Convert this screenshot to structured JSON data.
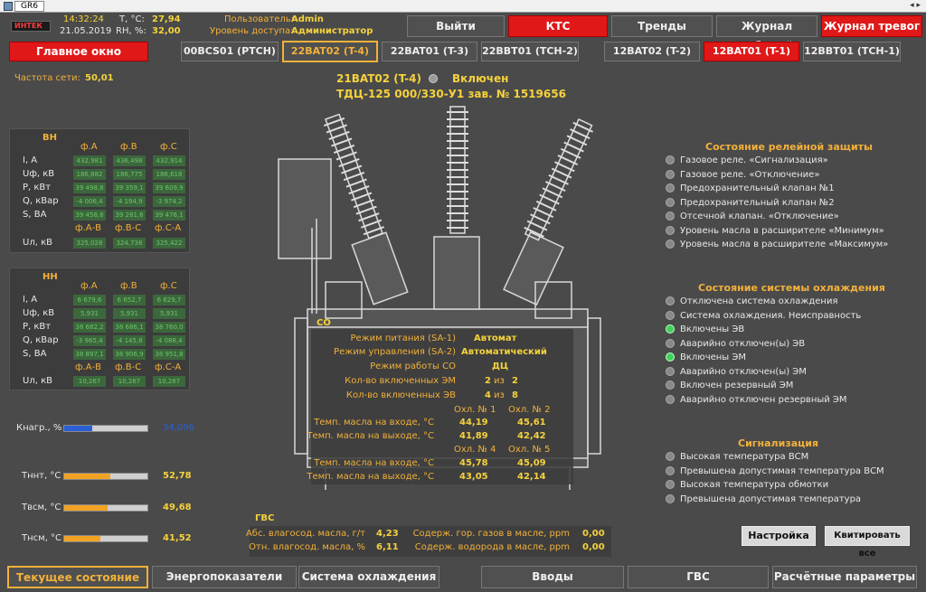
{
  "window": {
    "tab": "GR6",
    "arrows": "◂ ▸"
  },
  "header": {
    "logo": "ИНТЕК",
    "time": "14:32:24",
    "date": "21.05.2019",
    "temp_label": "T, °C:",
    "temp_value": "27,94",
    "rh_label": "RH, %:",
    "rh_value": "32,00",
    "user_label": "Пользователь:",
    "user_value": "Admin",
    "access_label": "Уровень доступа:",
    "access_value": "Администратор"
  },
  "top_buttons": {
    "exit": "Выйти",
    "kts": "КТС",
    "trends": "Тренды",
    "events": "Журнал событий",
    "alarms": "Журнал тревог"
  },
  "main_window_button": "Главное окно",
  "unit_tabs": [
    "00BCS01 (PTCH)",
    "22BAT02 (T-4)",
    "22BAT01 (T-3)",
    "22BBT01 (TCH-2)",
    "12BAT02 (T-2)",
    "12BAT01 (T-1)",
    "12BBT01 (TCH-1)"
  ],
  "frequency": {
    "label": "Частота сети:",
    "value": "50,01"
  },
  "transformer": {
    "name": "21BAT02 (T-4)",
    "state": "Включен",
    "model": "ТДЦ-125 000/330-У1 зав. № 1519656"
  },
  "vn": {
    "title": "ВН",
    "phase_headers": [
      "ф.А",
      "ф.В",
      "ф.С"
    ],
    "rows": [
      {
        "label": "I, А",
        "values": [
          "432,981",
          "436,498",
          "432,914"
        ]
      },
      {
        "label": "Uф, кВ",
        "values": [
          "186,882",
          "186,775",
          "186,618"
        ]
      },
      {
        "label": "P, кВт",
        "values": [
          "39 498,8",
          "39 359,1",
          "39 609,9"
        ]
      },
      {
        "label": "Q, кВар",
        "values": [
          "-4 006,4",
          "-4 194,9",
          "-3 974,2"
        ]
      },
      {
        "label": "S, ВА",
        "values": [
          "39 458,8",
          "39 281,6",
          "39 476,1"
        ]
      }
    ],
    "line_headers": [
      "ф.А-В",
      "ф.В-С",
      "ф.С-А"
    ],
    "ul_label": "Uл, кВ",
    "ul_values": [
      "325,028",
      "324,738",
      "325,422"
    ]
  },
  "nn": {
    "title": "НН",
    "phase_headers": [
      "ф.А",
      "ф.В",
      "ф.С"
    ],
    "rows": [
      {
        "label": "I, А",
        "values": [
          "6 679,6",
          "6 652,7",
          "6 629,7"
        ]
      },
      {
        "label": "Uф, кВ",
        "values": [
          "5,931",
          "5,931",
          "5,931"
        ]
      },
      {
        "label": "P, кВт",
        "values": [
          "38 682,2",
          "38 686,1",
          "38 760,0"
        ]
      },
      {
        "label": "Q, кВар",
        "values": [
          "-3 965,4",
          "-4 145,8",
          "-4 088,4"
        ]
      },
      {
        "label": "S, ВА",
        "values": [
          "38 897,1",
          "38 906,9",
          "38 951,8"
        ]
      }
    ],
    "line_headers": [
      "ф.А-В",
      "ф.В-С",
      "ф.С-А"
    ],
    "ul_label": "Uл, кВ",
    "ul_values": [
      "10,267",
      "10,267",
      "10,267"
    ]
  },
  "gauges": {
    "load": {
      "label": "Кнагр., %",
      "value": "34,096",
      "fraction": 0.34,
      "color": "#2b5fd8"
    },
    "tnnt": {
      "label": "Tннт, °C",
      "value": "52,78",
      "fraction": 0.55,
      "color": "#f2a324"
    },
    "tvsm": {
      "label": "Tвсм, °C",
      "value": "49,68",
      "fraction": 0.52,
      "color": "#f2a324"
    },
    "tnsm": {
      "label": "Tнсм, °C",
      "value": "41,52",
      "fraction": 0.44,
      "color": "#f2a324"
    }
  },
  "co": {
    "title": "СО",
    "rows": [
      {
        "label": "Режим питания (SA-1)",
        "value": "Автомат"
      },
      {
        "label": "Режим управления (SA-2)",
        "value": "Автоматический"
      },
      {
        "label": "Режим работы СО",
        "value": "ДЦ"
      }
    ],
    "em_label": "Кол-во включенных ЭМ",
    "em_value": "2",
    "em_of": "из",
    "em_total": "2",
    "ev_label": "Кол-во включенных ЭВ",
    "ev_value": "4",
    "ev_of": "из",
    "ev_total": "8",
    "cooler_headers_1": [
      "Охл. № 1",
      "Охл. № 2"
    ],
    "cooler_headers_2": [
      "Охл. № 4",
      "Охл. № 5"
    ],
    "in_label": "Темп. масла на входе, °C",
    "out_label": "Темп. масла на выходе, °C",
    "in_1": [
      "44,19",
      "45,61"
    ],
    "out_1": [
      "41,89",
      "42,42"
    ],
    "in_2": [
      "45,78",
      "45,09"
    ],
    "out_2": [
      "43,05",
      "42,14"
    ]
  },
  "gvs": {
    "title": "ГВС",
    "abs_label": "Абс. влагосод. масла, г/т",
    "abs_value": "4,23",
    "rel_label": "Отн. влагосод. масла, %",
    "rel_value": "6,11",
    "gas_label": "Содерж. гор. газов в масле, ppm",
    "gas_value": "0,00",
    "h2_label": "Содерж. водорода в масле, ppm",
    "h2_value": "0,00"
  },
  "relay_protection": {
    "title": "Состояние релейной защиты",
    "items": [
      {
        "label": "Газовое реле. «Сигнализация»",
        "on": false
      },
      {
        "label": "Газовое реле. «Отключение»",
        "on": false
      },
      {
        "label": "Предохранительный клапан №1",
        "on": false
      },
      {
        "label": "Предохранительный клапан №2",
        "on": false
      },
      {
        "label": "Отсечной клапан. «Отключение»",
        "on": false
      },
      {
        "label": "Уровень масла в расширителе «Минимум»",
        "on": false
      },
      {
        "label": "Уровень масла в расширителе «Максимум»",
        "on": false
      }
    ]
  },
  "cooling_state": {
    "title": "Состояние системы охлаждения",
    "items": [
      {
        "label": "Отключена система охлаждения",
        "on": false
      },
      {
        "label": "Система охлаждения. Неисправность",
        "on": false
      },
      {
        "label": "Включены ЭВ",
        "on": true
      },
      {
        "label": "Аварийно отключен(ы) ЭВ",
        "on": false
      },
      {
        "label": "Включены ЭМ",
        "on": true
      },
      {
        "label": "Аварийно отключен(ы) ЭМ",
        "on": false
      },
      {
        "label": "Включен резервный ЭМ",
        "on": false
      },
      {
        "label": "Аварийно отключен резервный ЭМ",
        "on": false
      }
    ]
  },
  "signaling": {
    "title": "Сигнализация",
    "items": [
      {
        "label": "Высокая температура ВСМ",
        "on": false
      },
      {
        "label": "Превышена допустимая температура ВСМ",
        "on": false
      },
      {
        "label": "Высокая температура обмотки",
        "on": false
      },
      {
        "label": "Превышена допустимая температура",
        "on": false
      }
    ]
  },
  "settings_button": "Настройка",
  "ack_button": "Квитировать все",
  "bottom_tabs": [
    "Текущее состояние",
    "Энергопоказатели",
    "Система охлаждения",
    "Вводы",
    "ГВС",
    "Расчётные параметры"
  ]
}
